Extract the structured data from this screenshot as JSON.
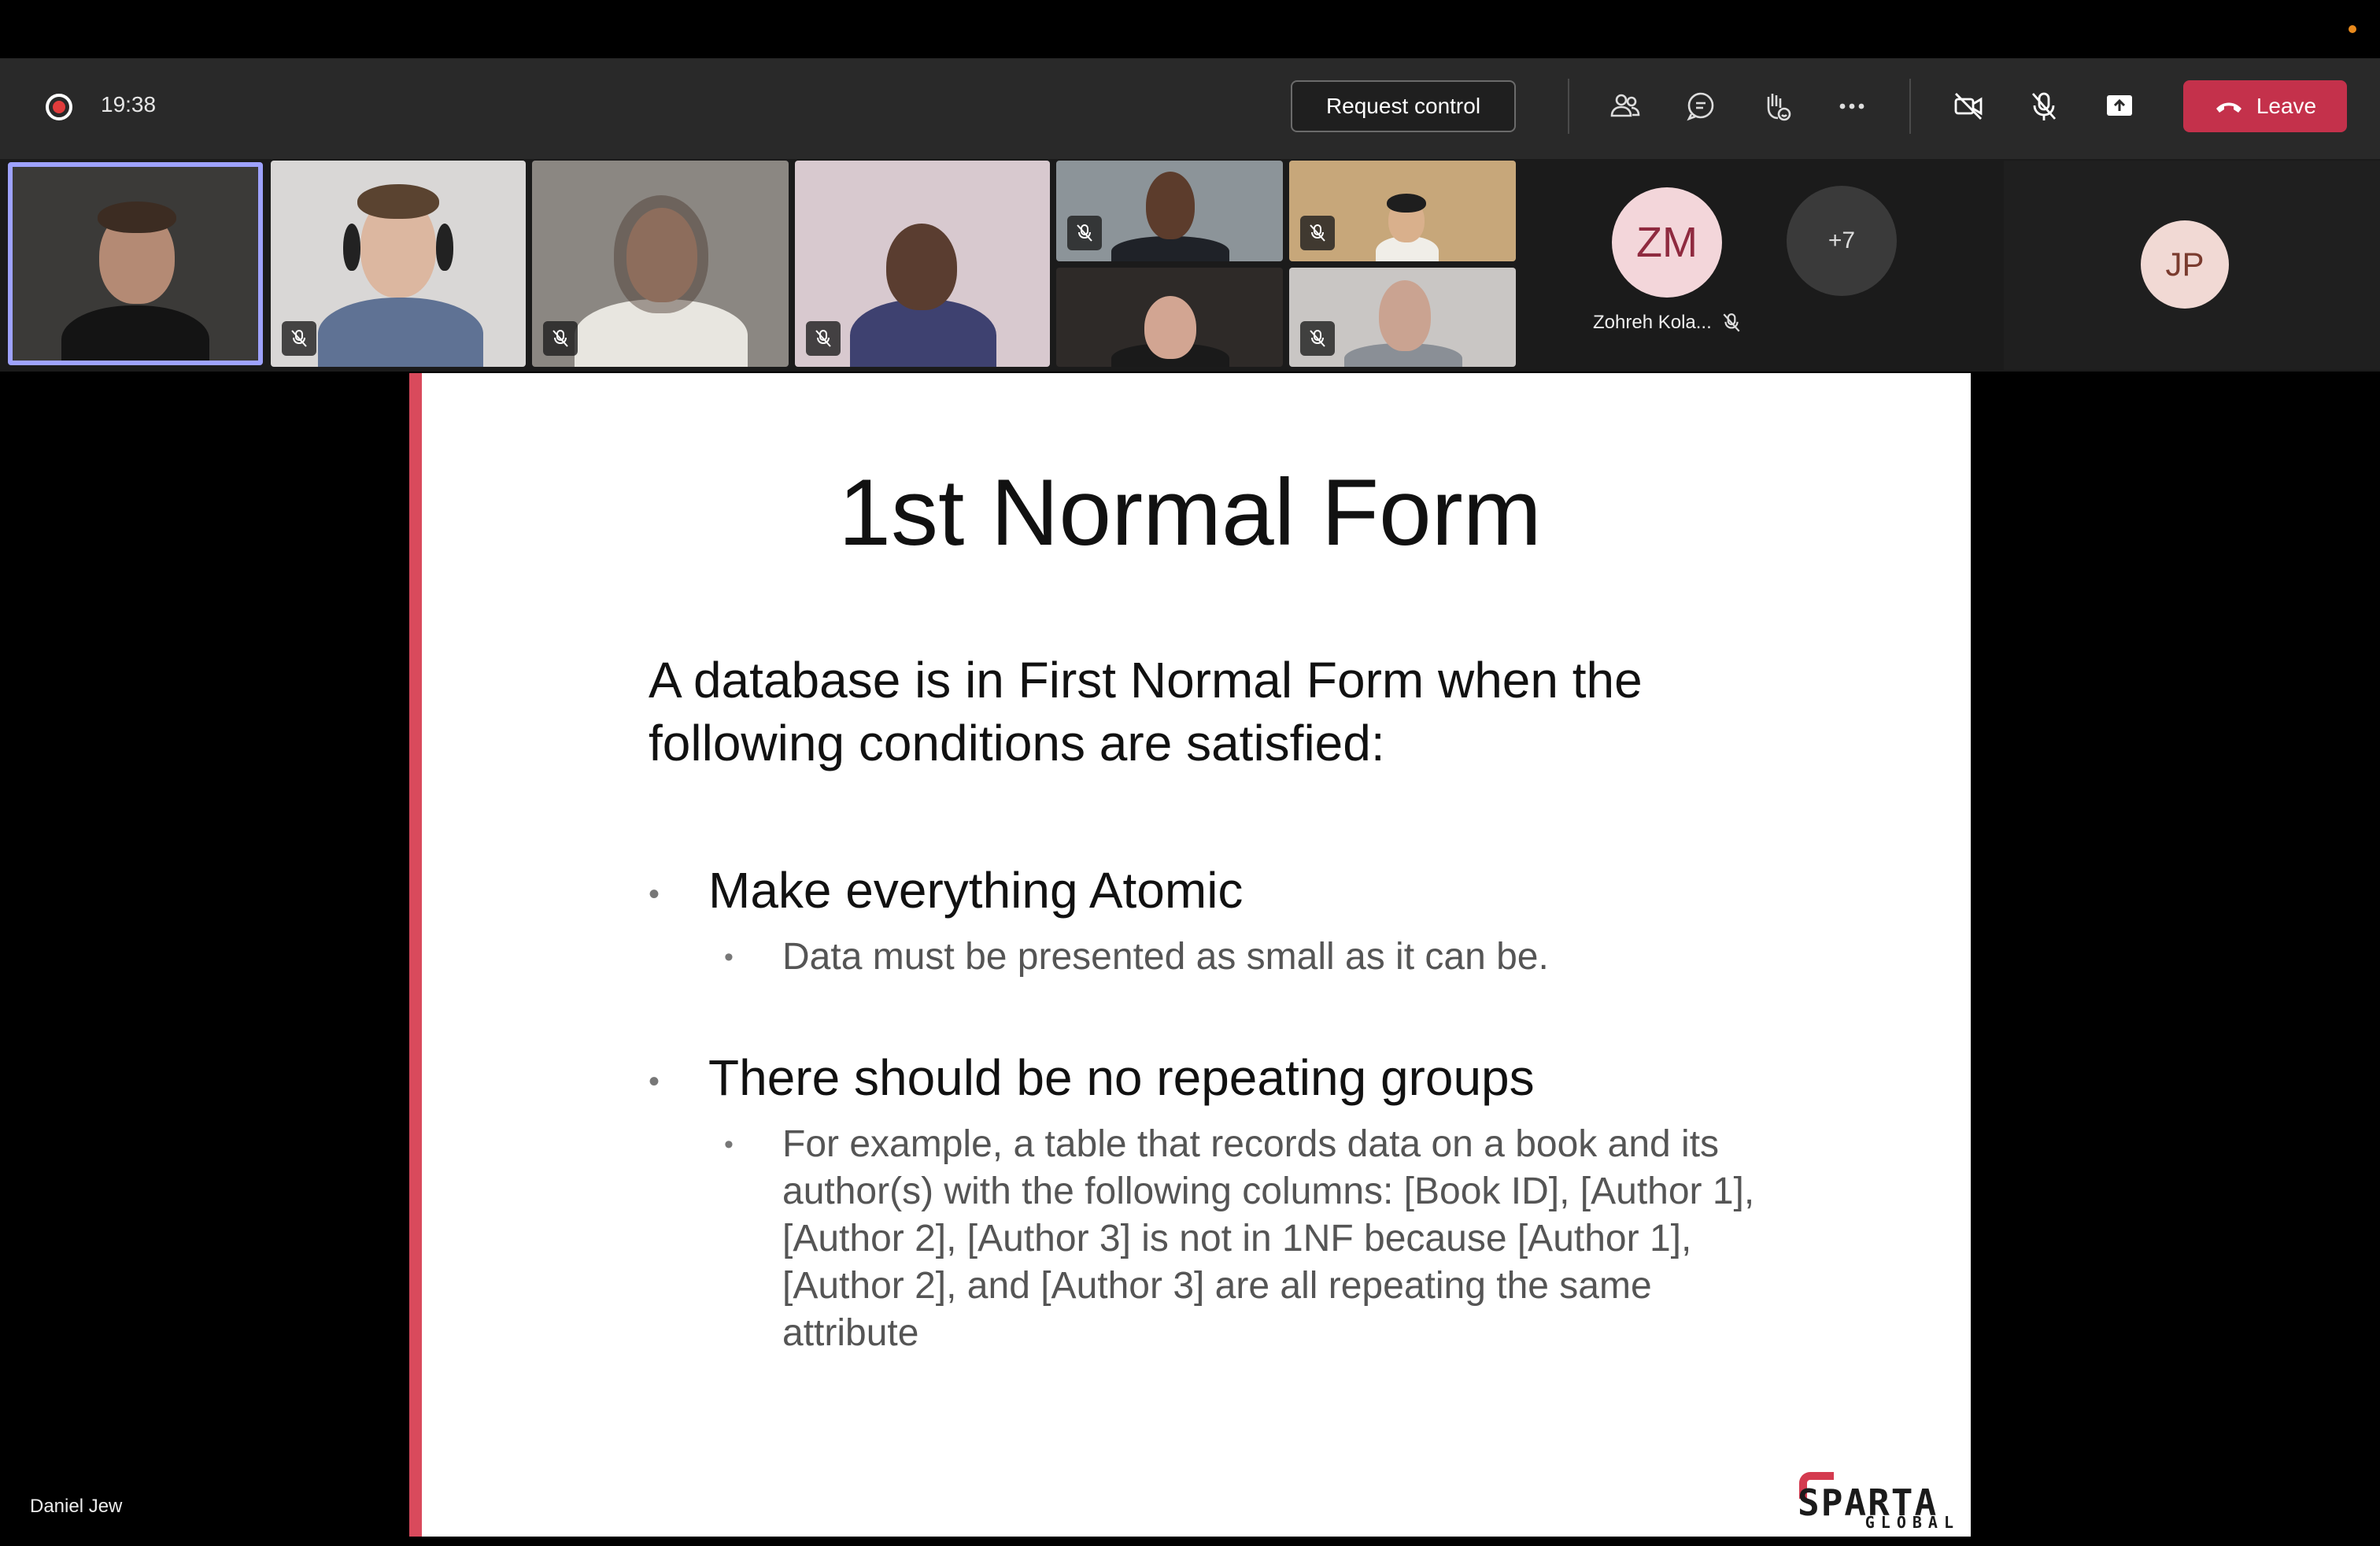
{
  "call": {
    "elapsed_time": "19:38",
    "request_control_label": "Request control",
    "leave_label": "Leave",
    "toolbar_icons": [
      "participants-icon",
      "chat-icon",
      "raise-hand-icon",
      "more-options-icon",
      "camera-off-icon",
      "mic-off-icon",
      "share-screen-icon"
    ]
  },
  "participants": {
    "overflow_count_label": "+7",
    "named_avatar": {
      "initials": "ZM",
      "name": "Zohreh Kola...",
      "muted": true
    },
    "side_avatar": {
      "initials": "JP"
    },
    "video_tiles": [
      {
        "speaking": true,
        "muted": false
      },
      {
        "muted": true
      },
      {
        "muted": true
      },
      {
        "muted": true
      },
      {
        "muted": true
      },
      {
        "muted": true
      },
      {
        "muted": false
      },
      {
        "muted": true
      }
    ]
  },
  "presenter": {
    "name": "Daniel Jew"
  },
  "slide": {
    "title": "1st Normal Form",
    "intro": "A database is in First Normal Form when the following conditions are satisfied:",
    "bullets": [
      {
        "heading": "Make everything Atomic",
        "sub": "Data must be presented as small as it can be."
      },
      {
        "heading": "There should be no repeating groups",
        "sub": "For example, a table that records data on a book and its author(s) with the following columns: [Book ID], [Author 1], [Author 2], [Author 3] is not in 1NF because [Author 1], [Author 2], and [Author 3] are all repeating the same attribute"
      }
    ],
    "logo": {
      "word": "SPARTA",
      "sub": "GLOBAL"
    },
    "accent_color": "#d94a5c"
  },
  "colors": {
    "leave_button": "#c4314b",
    "speaking_border": "#9ea2ff",
    "toolbar_bg": "#292929"
  }
}
